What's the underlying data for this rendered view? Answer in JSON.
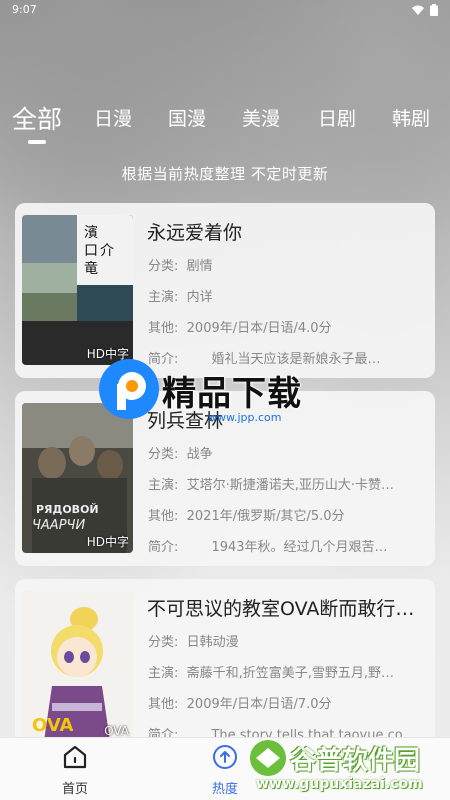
{
  "status": {
    "time": "9:07"
  },
  "tabs": [
    "全部",
    "日漫",
    "国漫",
    "美漫",
    "日剧",
    "韩剧"
  ],
  "subtitle": "根据当前热度整理 不定时更新",
  "labels": {
    "category": "分类:",
    "cast": "主演:",
    "other": "其他:",
    "intro": "简介:"
  },
  "cards": [
    {
      "title": "永远爱着你",
      "category": "剧情",
      "cast": "内详",
      "other": "2009年/日本/日语/4.0分",
      "intro": "婚礼当天应该是新娘永子最…",
      "tag": "HD中字",
      "poster_text": "濱口竜介"
    },
    {
      "title": "列兵查林",
      "category": "战争",
      "cast": "艾塔尔·斯捷潘诺夫,亚历山大·卡赞…",
      "other": "2021年/俄罗斯/其它/5.0分",
      "intro": "1943年秋。经过几个月艰苦…",
      "tag": "HD中字",
      "poster_text": "РЯДОВОЙ ЧААРЧИ"
    },
    {
      "title": "不可思议的教室OVA断而敢行…",
      "category": "日韩动漫",
      "cast": "斋藤千和,折笠富美子,雪野五月,野…",
      "other": "2009年/日本/日语/7.0分",
      "intro": "The story tells that taoyue co…",
      "tag": "OVA",
      "poster_text": ""
    }
  ],
  "nav": {
    "home": "首页",
    "hot": "热度"
  },
  "watermarks": {
    "w1_text": "精品下载",
    "w1_url": "www.jpp.com",
    "w2_text": "谷普软件园",
    "w2_url": "www.gupuxiazai.com"
  }
}
